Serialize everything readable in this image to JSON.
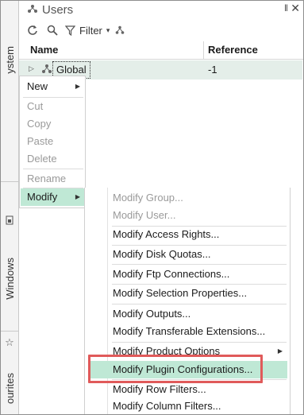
{
  "window": {
    "title": "Users",
    "pin_glyph": "‖",
    "close_glyph": "✕"
  },
  "left_strip": {
    "tabs": [
      {
        "label": "ystem"
      },
      {
        "label": "Windows"
      },
      {
        "label": "ourites"
      }
    ]
  },
  "toolbar": {
    "filter_label": "Filter",
    "caret": "▾"
  },
  "grid": {
    "columns": [
      "Name",
      "Reference"
    ],
    "rows": [
      {
        "expander": "▷",
        "name": "Global",
        "reference": "-1"
      }
    ]
  },
  "context_menu": {
    "items": [
      {
        "label": "New",
        "disabled": false,
        "submenu": true
      },
      {
        "label": "Cut",
        "disabled": true
      },
      {
        "label": "Copy",
        "disabled": true
      },
      {
        "label": "Paste",
        "disabled": true
      },
      {
        "label": "Delete",
        "disabled": true
      },
      {
        "label": "Rename",
        "disabled": true
      },
      {
        "label": "Modify",
        "disabled": false,
        "submenu": true,
        "highlighted": true
      }
    ],
    "arrow": "▶"
  },
  "submenu": {
    "items": [
      {
        "label": "Modify Group...",
        "disabled": true
      },
      {
        "label": "Modify User...",
        "disabled": true
      },
      {
        "label": "Modify Access Rights..."
      },
      {
        "label": "Modify Disk Quotas..."
      },
      {
        "label": "Modify Ftp Connections..."
      },
      {
        "label": "Modify Selection Properties..."
      },
      {
        "label": "Modify Outputs..."
      },
      {
        "label": "Modify Transferable Extensions..."
      },
      {
        "label": "Modify Product Options",
        "submenu": true
      },
      {
        "label": "Modify Plugin Configurations...",
        "highlighted": true
      },
      {
        "label": "Modify Row Filters..."
      },
      {
        "label": "Modify Column Filters..."
      }
    ],
    "arrow": "▶"
  },
  "colors": {
    "highlight": "#bfe8d5",
    "row_selected": "#e4eee9",
    "callout": "#e05a5a"
  }
}
